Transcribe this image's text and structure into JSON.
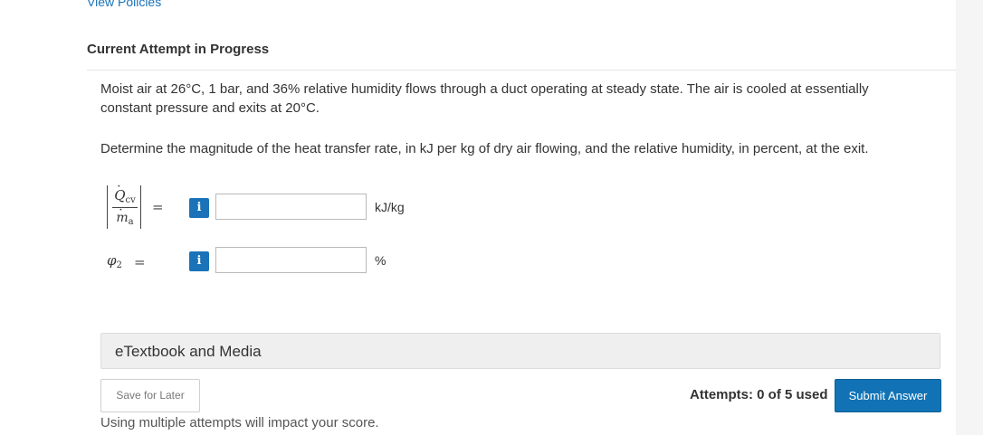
{
  "header": {
    "view_policies": "View Policies",
    "attempt_heading": "Current Attempt in Progress"
  },
  "question": {
    "text": "Moist air at 26°C, 1 bar, and 36% relative humidity flows through a duct operating at steady state. The air is cooled at essentially constant pressure and exits at 20°C.",
    "instruction": "Determine the magnitude of the heat transfer rate, in kJ per kg of dry air flowing, and the relative humidity, in percent, at the exit."
  },
  "answers": {
    "q1": {
      "numerator_symbol": "Q",
      "numerator_subscript": "cv",
      "denominator_symbol": "m",
      "denominator_subscript": "a",
      "equals": "=",
      "info_icon": "i",
      "value": "",
      "unit": "kJ/kg"
    },
    "q2": {
      "symbol": "φ",
      "subscript": "2",
      "equals": "=",
      "info_icon": "i",
      "value": "",
      "unit": "%"
    }
  },
  "resources": {
    "etextbook_label": "eTextbook and Media"
  },
  "footer": {
    "save_label": "Save for Later",
    "attempts_text": "Attempts: 0 of 5 used",
    "submit_label": "Submit Answer",
    "warning": "Using multiple attempts will impact your score."
  },
  "colors": {
    "accent": "#1173b5",
    "link": "#1a73b8",
    "panel_bg": "#ffffff",
    "page_bg": "#f5f5f5"
  }
}
